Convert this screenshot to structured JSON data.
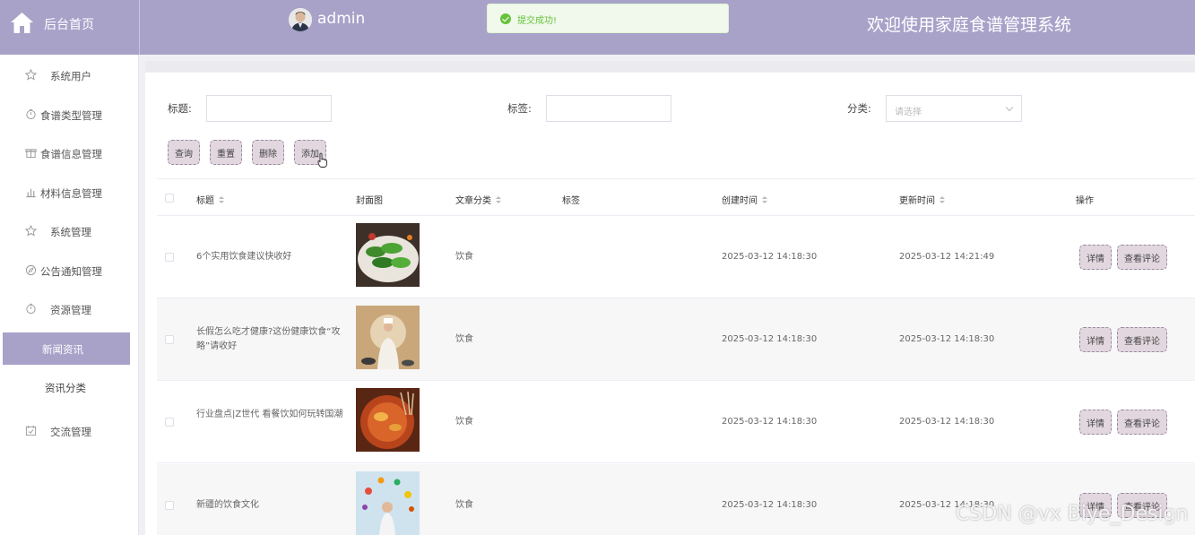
{
  "header": {
    "home_label": "后台首页",
    "username": "admin",
    "toast": "提交成功!",
    "site_title": "欢迎使用家庭食谱管理系统",
    "bg_color": "#a8a2c9"
  },
  "sidebar": {
    "items": [
      {
        "label": "系统用户",
        "icon": "star-icon"
      },
      {
        "label": "食谱类型管理",
        "icon": "timer-icon"
      },
      {
        "label": "食谱信息管理",
        "icon": "gift-icon"
      },
      {
        "label": "材料信息管理",
        "icon": "bar-chart-icon"
      },
      {
        "label": "系统管理",
        "icon": "star-icon"
      },
      {
        "label": "公告通知管理",
        "icon": "compass-icon"
      },
      {
        "label": "资源管理",
        "icon": "timer-icon"
      },
      {
        "label": "新闻资讯",
        "active": true
      },
      {
        "label": "资讯分类"
      },
      {
        "label": "交流管理",
        "icon": "calendar-check-icon"
      }
    ]
  },
  "filters": {
    "title_label": "标题:",
    "tag_label": "标签:",
    "category_label": "分类:",
    "category_placeholder": "请选择",
    "title_value": "",
    "tag_value": ""
  },
  "toolbar": {
    "query": "查询",
    "reset": "重置",
    "delete": "删除",
    "add": "添加"
  },
  "table": {
    "columns": [
      "标题",
      "封面图",
      "文章分类",
      "标签",
      "创建时间",
      "更新时间",
      "操作"
    ],
    "rows": [
      {
        "title": "6个实用饮食建议快收好",
        "category": "饮食",
        "tag": "",
        "created": "2025-03-12 14:18:30",
        "updated": "2025-03-12 14:21:49"
      },
      {
        "title": "长假怎么吃才健康?这份健康饮食“攻略”请收好",
        "category": "饮食",
        "tag": "",
        "created": "2025-03-12 14:18:30",
        "updated": "2025-03-12 14:18:30"
      },
      {
        "title": "行业盘点|Z世代 看餐饮如何玩转国潮",
        "category": "饮食",
        "tag": "",
        "created": "2025-03-12 14:18:30",
        "updated": "2025-03-12 14:18:30"
      },
      {
        "title": "新疆的饮食文化",
        "category": "饮食",
        "tag": "",
        "created": "2025-03-12 14:18:30",
        "updated": "2025-03-12 14:18:30"
      }
    ],
    "action_detail": "详情",
    "action_comments": "查看评论"
  },
  "watermark": "CSDN @vx Biye_Design"
}
